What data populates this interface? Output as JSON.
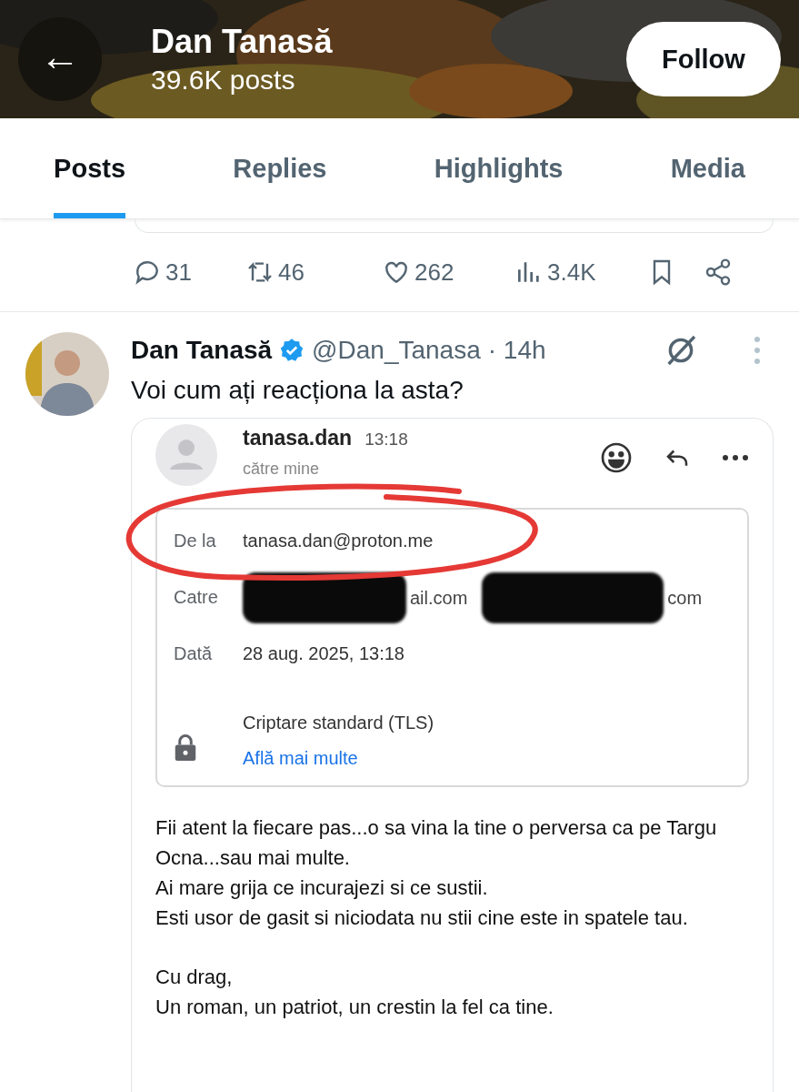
{
  "header": {
    "back": "←",
    "name": "Dan Tanasă",
    "posts_count": "39.6K posts",
    "follow_button": "Follow"
  },
  "tabs": [
    {
      "label": "Posts",
      "selected": true
    },
    {
      "label": "Replies",
      "selected": false
    },
    {
      "label": "Highlights",
      "selected": false
    },
    {
      "label": "Media",
      "selected": false
    }
  ],
  "previous_post_actions": {
    "replies": "31",
    "reposts": "46",
    "likes": "262",
    "views": "3.4K"
  },
  "post": {
    "author": "Dan Tanasă",
    "verified": true,
    "handle": "@Dan_Tanasa",
    "time": "· 14h",
    "text": "Voi cum ați reacționa la asta?",
    "email": {
      "sender": "tanasa.dan",
      "time": "13:18",
      "recipient_line": "către mine",
      "details": [
        {
          "kind": "text",
          "label": "De la",
          "value": "tanasa.dan@proton.me"
        },
        {
          "kind": "redacted",
          "label": "Catre",
          "fragments": [
            "ail.com",
            "com"
          ]
        },
        {
          "kind": "text",
          "label": "Dată",
          "value": "28 aug. 2025, 13:18"
        }
      ],
      "encryption": "Criptare standard (TLS)",
      "learn_more": "Află mai multe",
      "body": [
        "Fii atent la fiecare pas...o sa vina la tine o perversa ca pe Targu Ocna...sau mai multe.",
        "Ai mare grija ce incurajezi si ce sustii.",
        "Esti usor de gasit si niciodata nu stii cine este in spatele tau."
      ],
      "signature": [
        "Cu drag,",
        "Un roman, un patriot, un crestin la fel ca tine."
      ]
    }
  }
}
